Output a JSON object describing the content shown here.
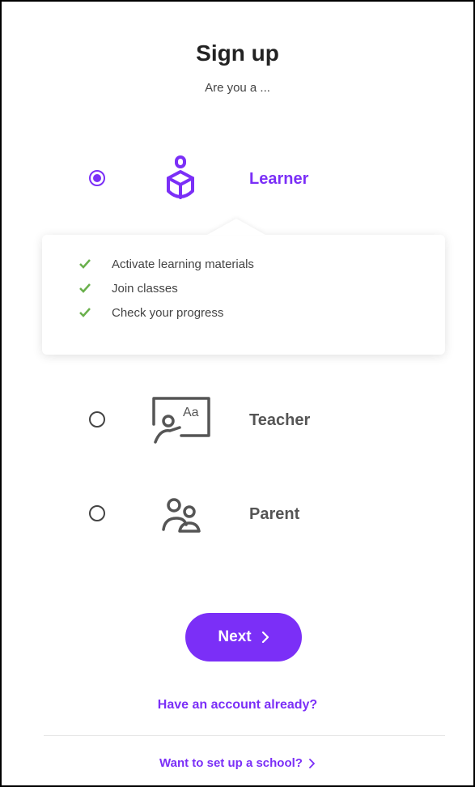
{
  "header": {
    "title": "Sign up",
    "subtitle": "Are you a ..."
  },
  "roles": [
    {
      "label": "Learner",
      "selected": true,
      "icon": "learner-icon"
    },
    {
      "label": "Teacher",
      "selected": false,
      "icon": "teacher-board-icon"
    },
    {
      "label": "Parent",
      "selected": false,
      "icon": "parent-icon"
    }
  ],
  "learner_benefits": [
    "Activate learning materials",
    "Join classes",
    "Check your progress"
  ],
  "teacher_icon_text": "Aa",
  "actions": {
    "next_label": "Next",
    "have_account_label": "Have an account already?",
    "school_label": "Want to set up a school?"
  },
  "colors": {
    "accent": "#7b2ff7",
    "check": "#6ab04c",
    "text_dark": "#222222",
    "icon_gray": "#555555"
  }
}
